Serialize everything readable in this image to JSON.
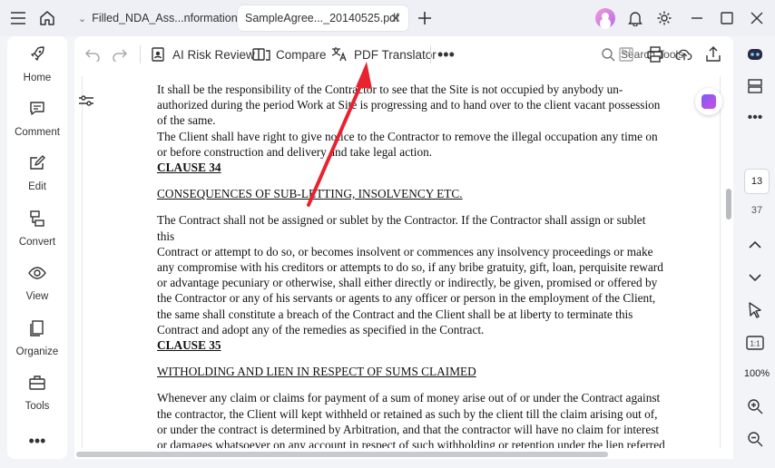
{
  "tabs": [
    {
      "label": "Filled_NDA_Ass...nformation.pdf",
      "active": false
    },
    {
      "label": "SampleAgree..._20140525.pdf",
      "active": true
    }
  ],
  "sidebar": {
    "items": [
      {
        "label": "Home",
        "icon": "rocket-icon"
      },
      {
        "label": "Comment",
        "icon": "comment-icon"
      },
      {
        "label": "Edit",
        "icon": "edit-icon"
      },
      {
        "label": "Convert",
        "icon": "convert-icon"
      },
      {
        "label": "View",
        "icon": "eye-icon"
      },
      {
        "label": "Organize",
        "icon": "organize-icon"
      },
      {
        "label": "Tools",
        "icon": "toolbox-icon"
      }
    ]
  },
  "toolbar": {
    "ai_risk_review": "AI Risk Review",
    "compare": "Compare",
    "pdf_translator": "PDF Translator",
    "search_tools": "Search Tools"
  },
  "document": {
    "lines": [
      "It shall be the responsibility of the Contractor to see that the Site is not occupied by anybody un-",
      "authorized during the period Work at Site is progressing and to hand over to the client vacant possession",
      "of the same.",
      "The Client shall have right to give notice to the Contractor to remove the illegal occupation any time on",
      "or before construction and delivery and take legal action."
    ],
    "clause34_heading": "CLAUSE 34",
    "clause34_title": "CONSEQUENCES OF SUB-LETTING, INSOLVENCY ETC.",
    "clause34_body": [
      "The Contract shall not be assigned or sublet by the Contractor. If the Contractor shall assign or sublet this",
      "Contract or attempt to do so, or becomes insolvent or commences any insolvency proceedings or make",
      "any compromise with his creditors or attempts to do so, if any bribe gratuity, gift, loan, perquisite reward",
      "or advantage pecuniary or otherwise, shall either directly or indirectly, be given, promised or offered by",
      "the Contractor or any of his servants or agents to any officer or person in the employment of the Client,",
      "the same shall constitute a breach of the Contract and the Client shall be at liberty to terminate this",
      "Contract and adopt any of the remedies as specified in the Contract."
    ],
    "clause35_heading": "CLAUSE 35",
    "clause35_title": "WITHOLDING AND LIEN IN RESPECT OF SUMS CLAIMED",
    "clause35_body": [
      "Whenever any claim or claims for payment of a sum of money arise out of or under the Contract against",
      "the contractor, the Client will kept withheld or retained as such by the client till the claim arising out of,",
      "or under the contract is determined by Arbitration, and that the contractor will have no claim for interest",
      "or damages whatsoever on any account in respect of such withholding or retention under the lien referred"
    ]
  },
  "navigation": {
    "current_page": "13",
    "total_pages": "37",
    "zoom": "100%"
  },
  "colors": {
    "annotation_arrow": "#e8232f",
    "accent": "#7a5cf5"
  }
}
